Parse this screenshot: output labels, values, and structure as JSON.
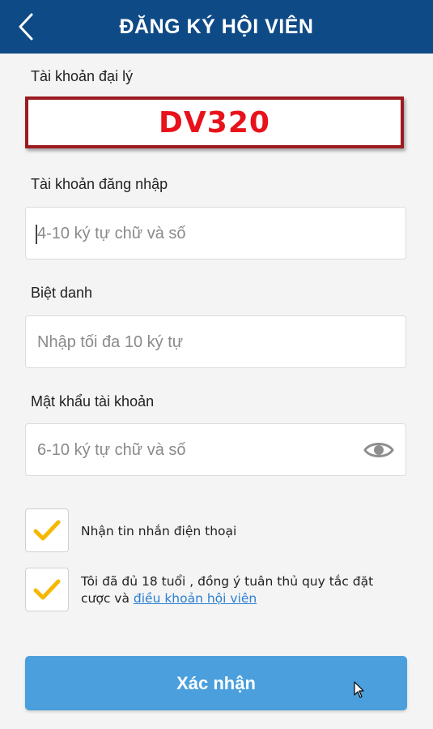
{
  "header": {
    "title": "ĐĂNG KÝ HỘI VIÊN",
    "back_icon": "chevron-left-icon"
  },
  "agent_account": {
    "label": "Tài khoản đại lý",
    "value": "DV320",
    "border_color": "#9b1b1f",
    "text_color": "#e8121b"
  },
  "login_account": {
    "label": "Tài khoản đăng nhập",
    "placeholder": "4-10 ký tự chữ và số"
  },
  "nickname": {
    "label": "Biệt danh",
    "placeholder": "Nhập tối đa 10 ký tự"
  },
  "password": {
    "label": "Mật khẩu tài khoản",
    "placeholder": "6-10 ký tự chữ và số",
    "toggle_icon": "eye-icon"
  },
  "checkboxes": [
    {
      "text": "Nhận tin nhắn điện thoại",
      "checked": true
    },
    {
      "text": "Tôi đã đủ 18 tuổi , đồng ý tuân thủ quy tắc đặt cược và ",
      "link": "điều khoản hội viên",
      "checked": true
    }
  ],
  "submit": {
    "label": "Xác nhận"
  },
  "colors": {
    "header_bg": "#0e4a86",
    "button_bg": "#4a9fdc",
    "check_color": "#f5b800",
    "link_color": "#2a7fd4"
  }
}
